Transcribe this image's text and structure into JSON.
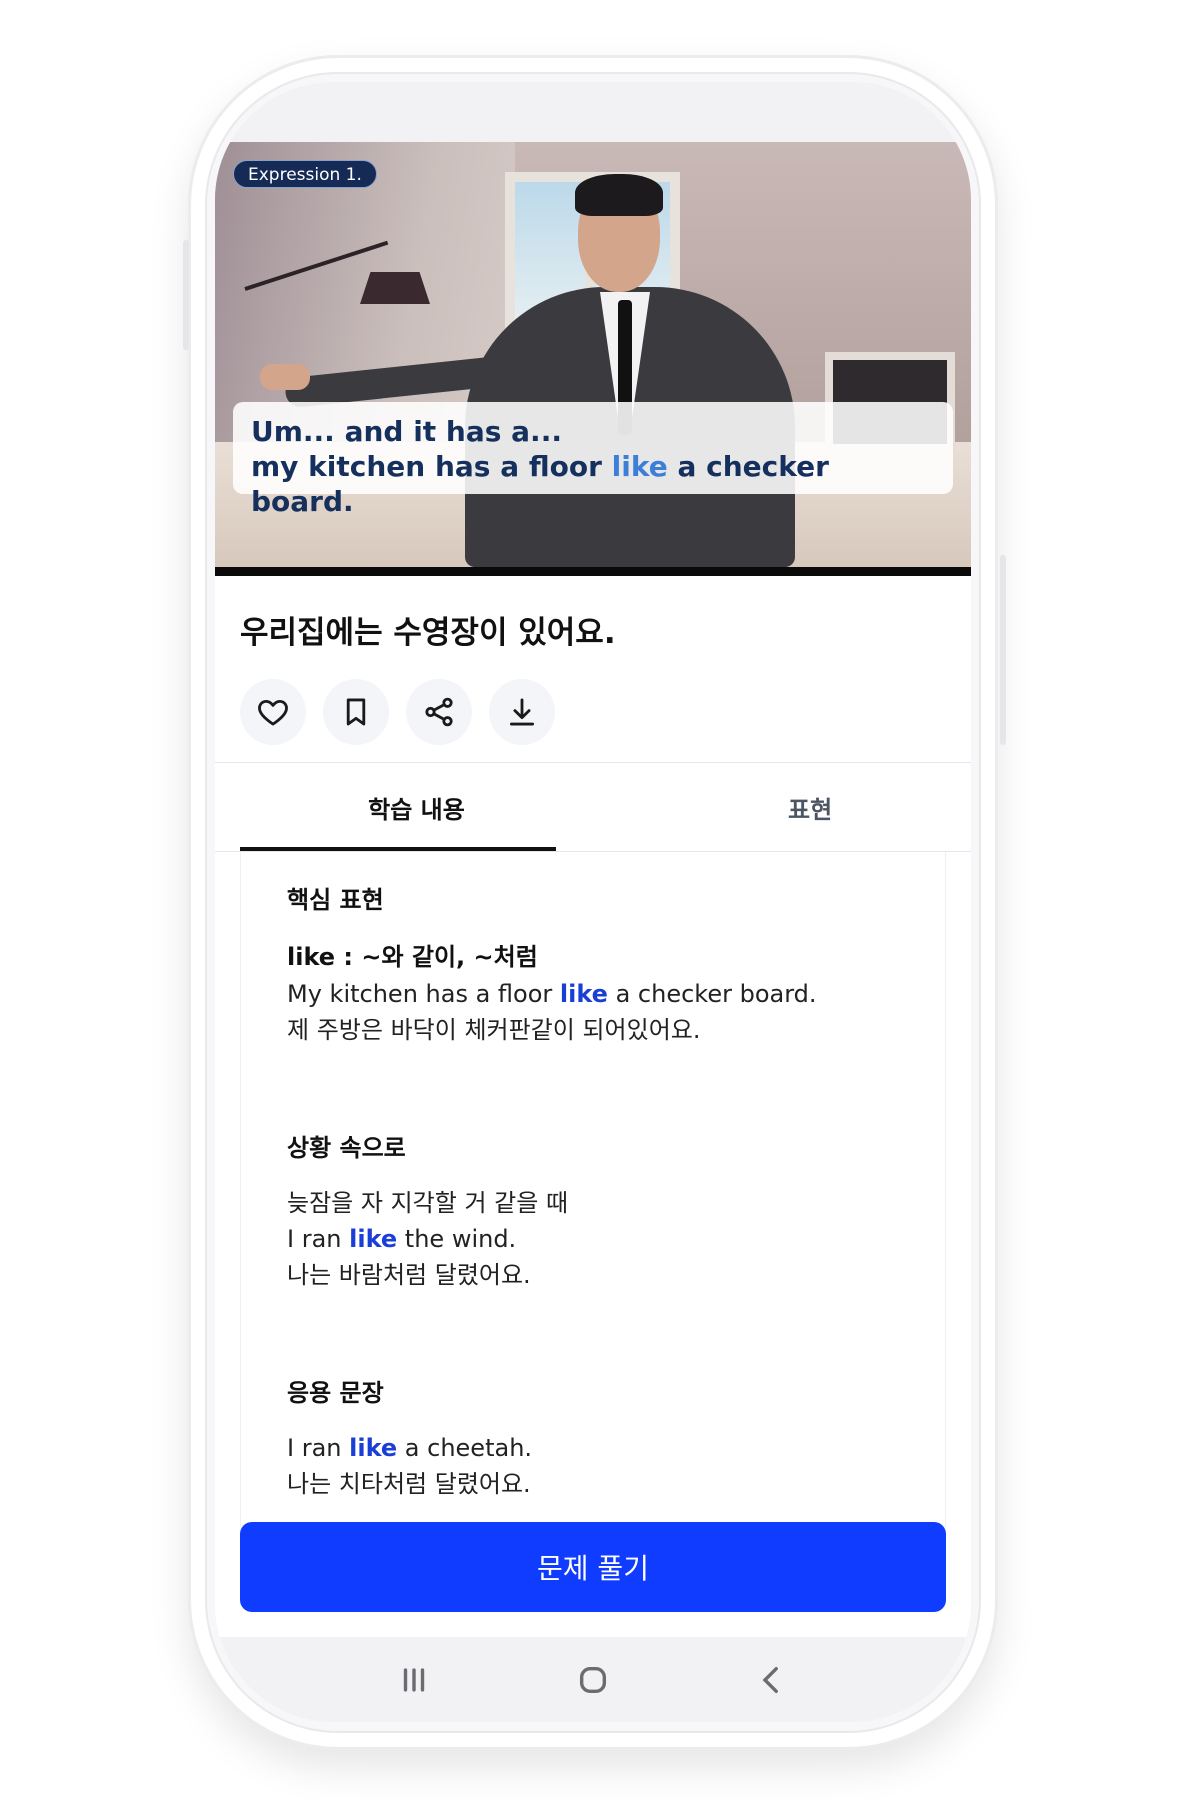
{
  "video": {
    "badge": "Expression 1.",
    "caption_line1": "Um... and it has a...",
    "caption_line2_pre": "my kitchen has a floor ",
    "caption_line2_hl": "like",
    "caption_line2_post": " a checker board."
  },
  "title": "우리집에는 수영장이 있어요.",
  "actions": {
    "like_icon": "heart-icon",
    "bookmark_icon": "bookmark-icon",
    "share_icon": "share-icon",
    "download_icon": "download-icon"
  },
  "tabs": [
    {
      "label": "학습 내용",
      "active": true
    },
    {
      "label": "표현",
      "active": false
    }
  ],
  "sections": {
    "core": {
      "heading": "핵심 표현",
      "keyword": "like : ~와 같이, ~처럼",
      "example_pre": "My kitchen has a floor ",
      "example_hl": "like",
      "example_post": " a checker board.",
      "translation": "제 주방은 바닥이 체커판같이 되어있어요."
    },
    "situation": {
      "heading": "상황 속으로",
      "context": "늦잠을 자 지각할 거 같을 때",
      "example_pre": "I ran ",
      "example_hl": "like",
      "example_post": " the wind.",
      "translation": "나는 바람처럼 달렸어요."
    },
    "applied": {
      "heading": "응용 문장",
      "example_pre": "I ran ",
      "example_hl": "like",
      "example_post": " a cheetah.",
      "translation": "나는 치타처럼 달렸어요."
    }
  },
  "cta_label": "문제 풀기",
  "navbar": {
    "recent_icon": "recent-apps-icon",
    "home_icon": "home-icon",
    "back_icon": "back-icon"
  },
  "colors": {
    "accent": "#0f3cff",
    "highlight": "#1a3fd6",
    "caption_text": "#16305e",
    "badge_bg": "#152a55"
  }
}
